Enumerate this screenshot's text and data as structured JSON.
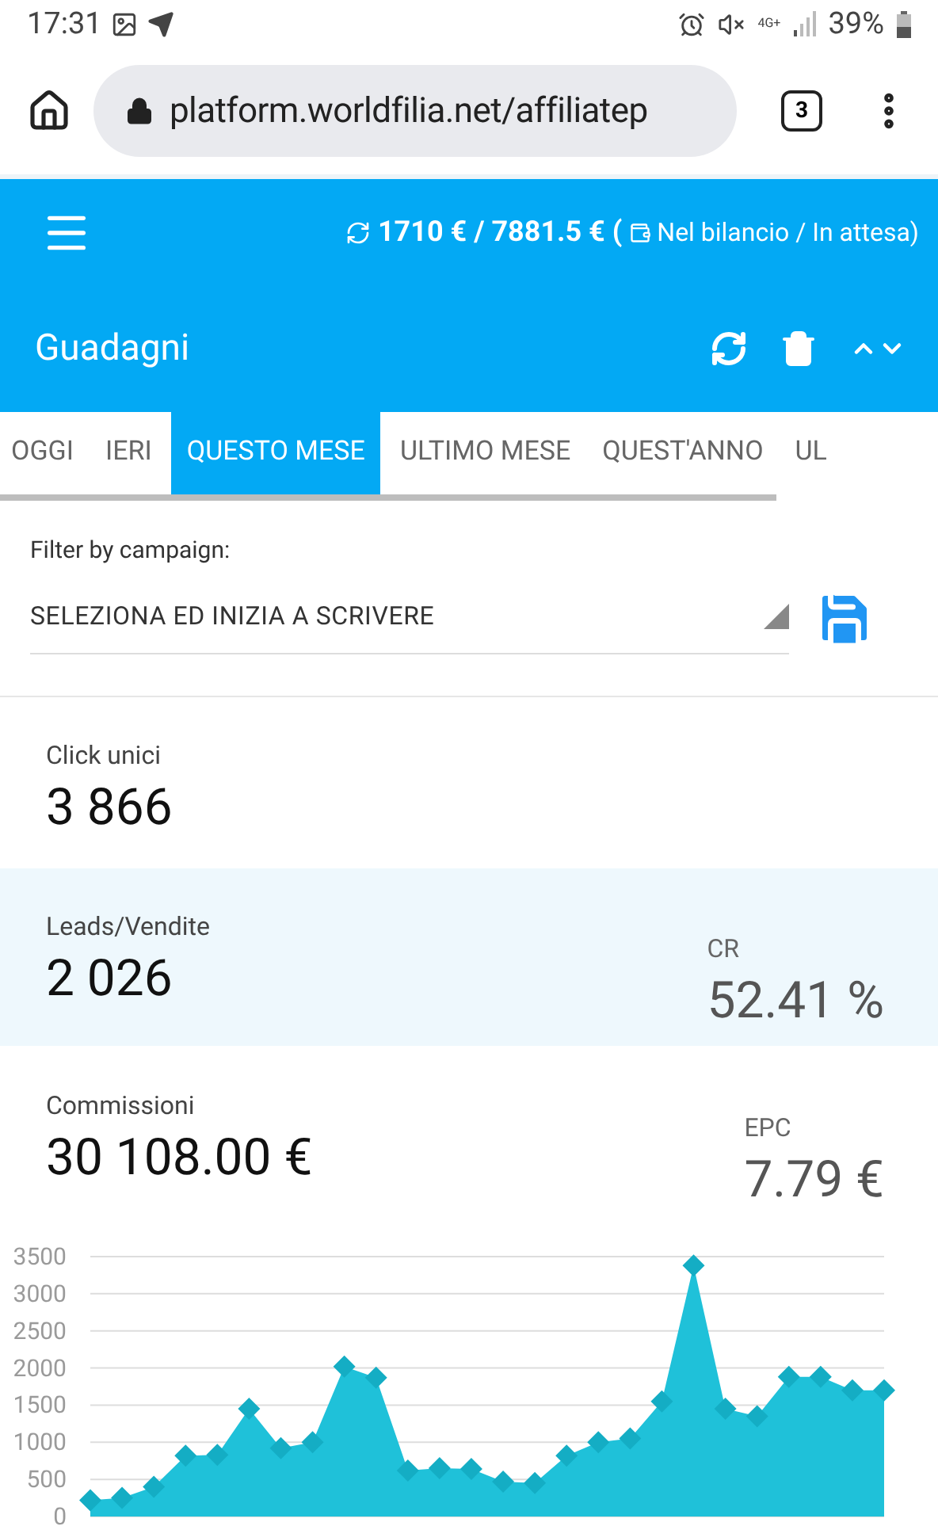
{
  "status_bar": {
    "time": "17:31",
    "network": "4G+",
    "battery": "39%"
  },
  "browser": {
    "url": "platform.worldfilia.net/affiliatep",
    "tab_count": "3"
  },
  "header": {
    "summary": "1710 € / 7881.5 € (",
    "legend": "Nel bilancio / In attesa)",
    "title": "Guadagni"
  },
  "tabs": [
    {
      "label": "OGGI",
      "selected": false
    },
    {
      "label": "IERI",
      "selected": false
    },
    {
      "label": "QUESTO MESE",
      "selected": true
    },
    {
      "label": "ULTIMO MESE",
      "selected": false
    },
    {
      "label": "QUEST'ANNO",
      "selected": false
    },
    {
      "label": "UL",
      "selected": false
    }
  ],
  "filter": {
    "label": "Filter by campaign:",
    "placeholder": "SELEZIONA ED INIZIA A SCRIVERE"
  },
  "stats": [
    {
      "label": "Click unici",
      "value": "3 866"
    },
    {
      "label": "Leads/Vendite",
      "value": "2 026",
      "side_label": "CR",
      "side_value": "52.41 %"
    },
    {
      "label": "Commissioni",
      "value": "30 108.00 €",
      "side_label": "EPC",
      "side_value": "7.79 €"
    }
  ],
  "chart_data": {
    "type": "area",
    "grid": true,
    "yticks": [
      0,
      500,
      1000,
      1500,
      2000,
      2500,
      3000,
      3500
    ],
    "ylim": [
      0,
      3500
    ],
    "series": [
      {
        "color": "#1fc1d9",
        "values": [
          220,
          250,
          400,
          820,
          830,
          1450,
          920,
          1000,
          2020,
          1870,
          620,
          650,
          640,
          470,
          450,
          820,
          1000,
          1050,
          1550,
          3380,
          1450,
          1350,
          1880,
          1880,
          1700,
          1700
        ]
      }
    ]
  }
}
